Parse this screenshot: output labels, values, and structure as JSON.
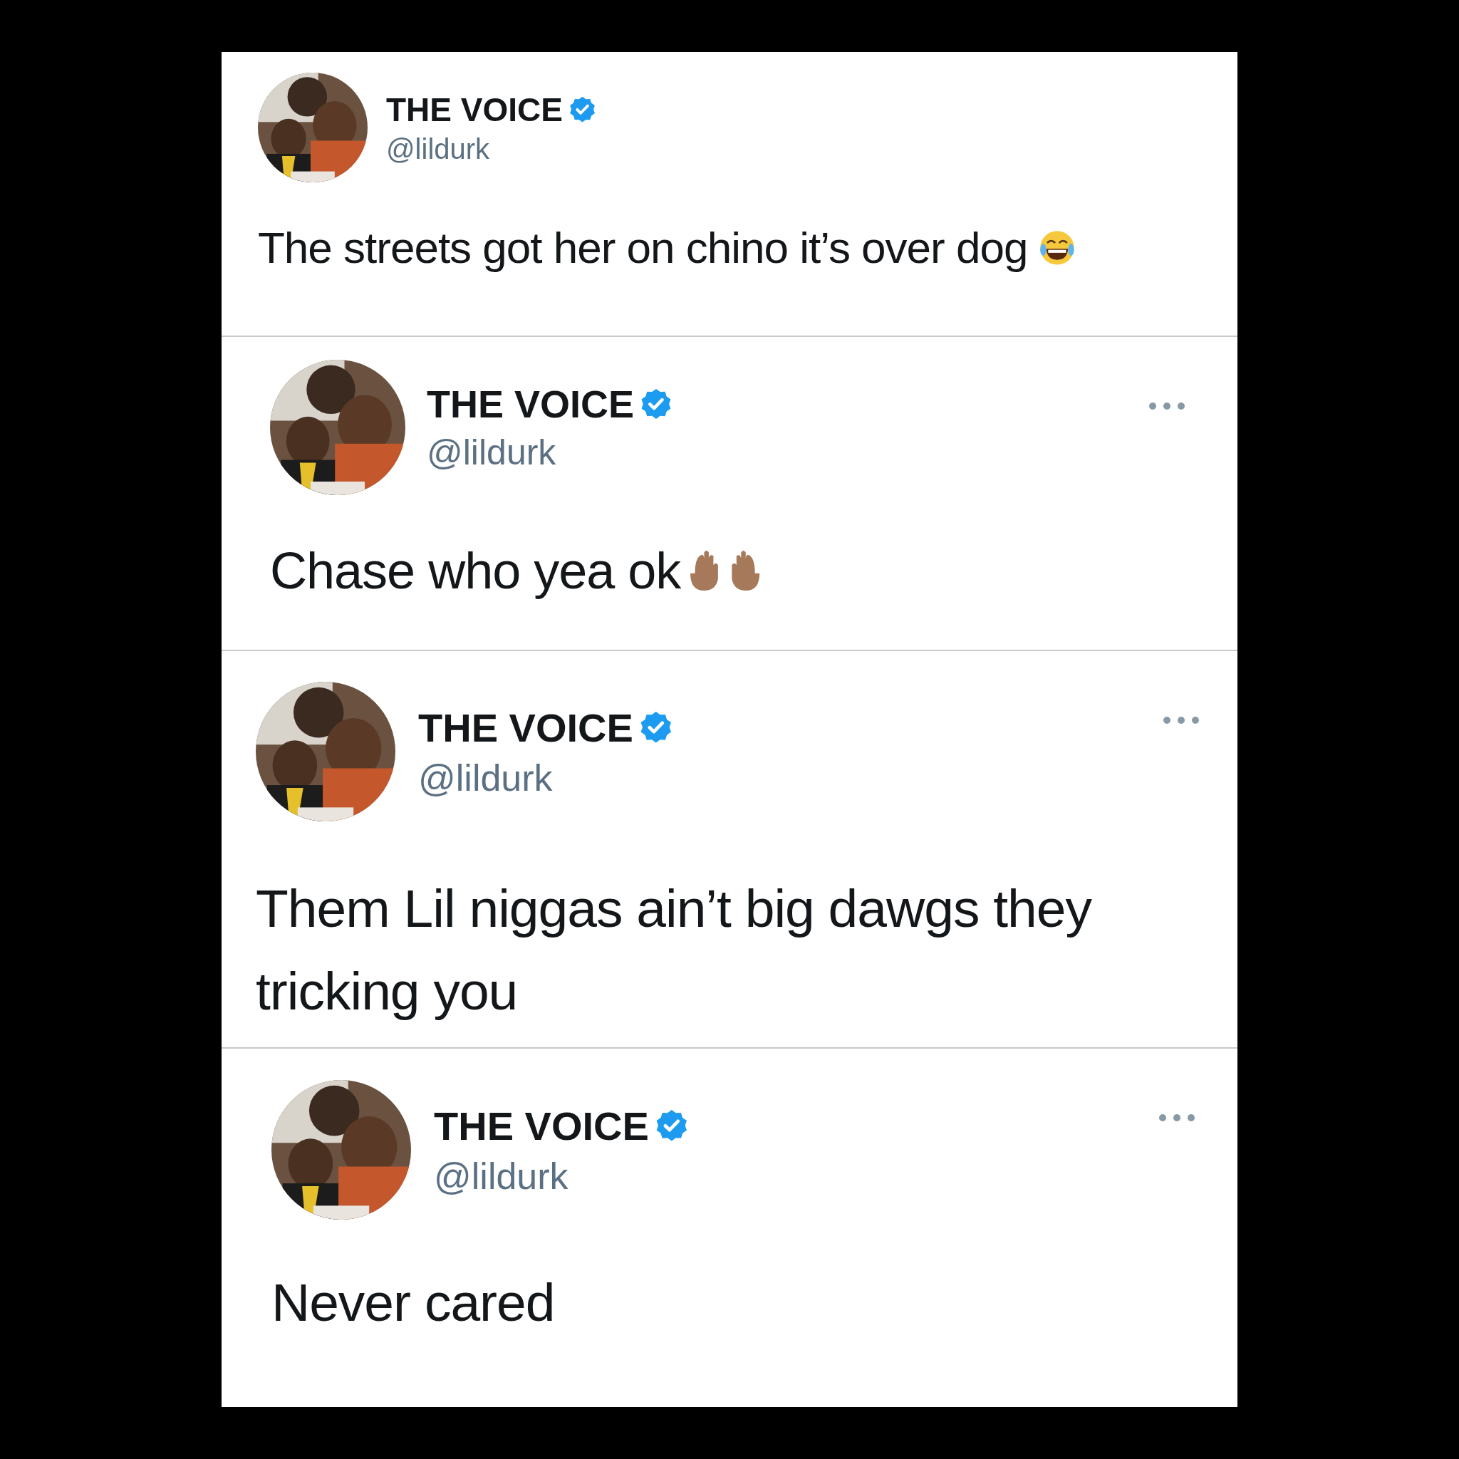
{
  "tweets": [
    {
      "name": "THE VOICE",
      "verified": true,
      "handle": "@lildurk",
      "text": "The streets got her on chino it’s over dog",
      "kind": "laughing",
      "menu": false
    },
    {
      "name": "THE VOICE",
      "verified": true,
      "handle": "@lildurk",
      "text": "Chase who yea ok",
      "kind": "palms",
      "menu": true
    },
    {
      "name": "THE VOICE",
      "verified": true,
      "handle": "@lildurk",
      "text": "Them Lil niggas ain’t big dawgs they tricking you",
      "kind": "plain",
      "menu": true
    },
    {
      "name": "THE VOICE",
      "verified": true,
      "handle": "@lildurk",
      "text": "Never cared",
      "kind": "plain",
      "menu": true
    }
  ]
}
